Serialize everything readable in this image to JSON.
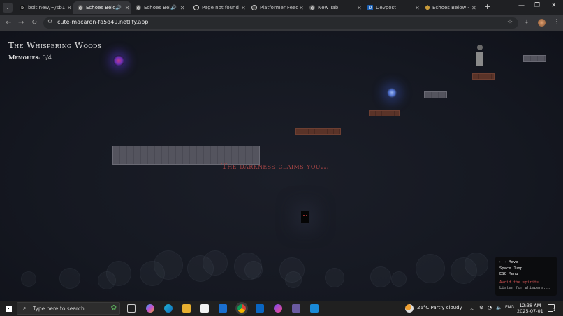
{
  "browser": {
    "tabs": [
      {
        "label": "bolt.new/~/sb1",
        "favicon": "bolt-icon",
        "color": "#111111",
        "sound": false
      },
      {
        "label": "Echoes Below",
        "favicon": "globe-icon",
        "color": "#5a5a5a",
        "sound": true,
        "active": true
      },
      {
        "label": "Echoes Below",
        "favicon": "globe-icon",
        "color": "#5a5a5a",
        "sound": true
      },
      {
        "label": "Page not found",
        "favicon": "github-icon",
        "color": "#222222",
        "sound": false
      },
      {
        "label": "Platformer Feed",
        "favicon": "openai-icon",
        "color": "#444444",
        "sound": false
      },
      {
        "label": "New Tab",
        "favicon": "globe-icon",
        "color": "#5a5a5a",
        "sound": false
      },
      {
        "label": "Devpost",
        "favicon": "devpost-icon",
        "color": "#1a5fb4",
        "sound": false
      },
      {
        "label": "Echoes Below - ",
        "favicon": "gem-icon",
        "color": "#c89a3a",
        "sound": false
      }
    ],
    "new_tab_label": "+",
    "url": "cute-macaron-fa5d49.netlify.app",
    "window_controls": {
      "minimize": "—",
      "restore": "❐",
      "close": "✕"
    }
  },
  "game": {
    "title": "The Whispering Woods",
    "memories_label": "Memories:",
    "memories_value": "0/4",
    "message": "The darkness claims you...",
    "help": {
      "move": "← → Move",
      "jump": "Space Jump",
      "menu": "ESC Menu",
      "warning": "Avoid the spirits",
      "hint": "Listen for whispers..."
    },
    "colors": {
      "message": "#a84646",
      "warning": "#c85050"
    }
  },
  "taskbar": {
    "search_placeholder": "Type here to search",
    "weather": "26°C  Partly cloudy",
    "language": "ENG",
    "time": "12:38 AM",
    "date": "2025-07-01",
    "notifications": "1"
  }
}
